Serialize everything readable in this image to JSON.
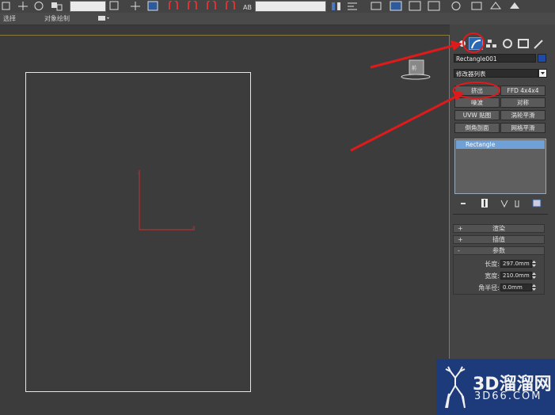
{
  "ribbon": {
    "selection_label": "选择",
    "object_paint_label": "对象绘制"
  },
  "command_panel": {
    "object_name": "Rectangle001",
    "object_color": "#1e4aa8",
    "modifier_list": "修改器列表",
    "modifier_buttons": [
      "挤出",
      "FFD 4x4x4",
      "噪波",
      "对称",
      "UVW 贴图",
      "涡轮平滑",
      "倒角剖面",
      "网格平滑"
    ],
    "stack": [
      "Rectangle"
    ],
    "rollouts": {
      "rendering": {
        "sign": "+",
        "title": "渲染"
      },
      "interpolation": {
        "sign": "+",
        "title": "插值"
      },
      "parameters": {
        "sign": "-",
        "title": "参数"
      }
    },
    "params": {
      "length_label": "长度:",
      "length_value": "297.0mm",
      "width_label": "宽度:",
      "width_value": "210.0mm",
      "corner_label": "角半径:",
      "corner_value": "0.0mm"
    }
  },
  "watermark": {
    "text": "3D溜溜网",
    "subtext": "3D66.COM"
  },
  "annotation_color": "#e01a1a"
}
